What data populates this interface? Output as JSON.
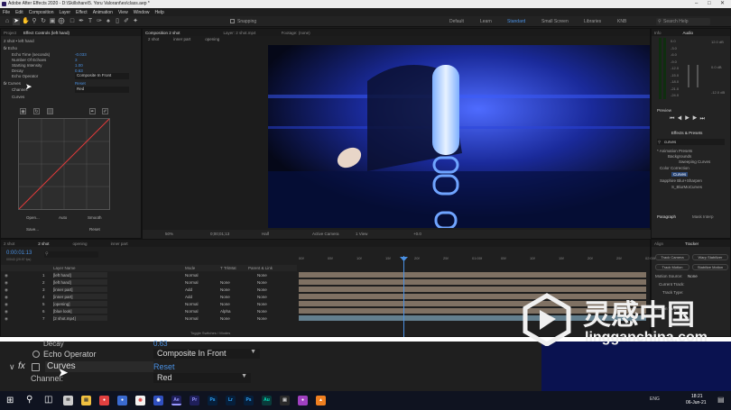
{
  "window": {
    "title": "Adobe After Effects 2020 - D:\\Skillshare\\5. Yoru Valorant\\es\\class.aep *"
  },
  "menu": [
    "File",
    "Edit",
    "Composition",
    "Layer",
    "Effect",
    "Animation",
    "View",
    "Window",
    "Help"
  ],
  "toolbar": {
    "snapping": "Snapping",
    "workspaces": [
      "Default",
      "Learn",
      "Standard",
      "Small Screen",
      "Libraries",
      "KNB"
    ],
    "search_placeholder": "Search Help"
  },
  "effect_controls": {
    "tabs": [
      "Project",
      "Effect Controls (left hand)"
    ],
    "header": "2 shot • left hand",
    "echo": {
      "label": "Echo",
      "reset": "Reset",
      "props": [
        {
          "name": "Echo Time (seconds)",
          "value": "-0.033"
        },
        {
          "name": "Number Of Echoes",
          "value": "3"
        },
        {
          "name": "Starting Intensity",
          "value": "1.00"
        },
        {
          "name": "Decay",
          "value": "0.63"
        },
        {
          "name": "Echo Operator",
          "value": "Composite In Front"
        }
      ]
    },
    "curves": {
      "label": "Curves",
      "reset": "Reset",
      "channel_label": "Channel:",
      "channel_value": "Red",
      "curves_sub": "Curves",
      "buttons": [
        "Open...",
        "Auto",
        "Smooth",
        "Save...",
        "Reset"
      ]
    }
  },
  "composition": {
    "tabs": [
      "Composition 2 shot"
    ],
    "subtabs": [
      "2 shot",
      "inner part",
      "opening"
    ],
    "layer_tab": "Layer: 2 shot.mp4",
    "footage_tab": "Footage: (none)",
    "bottom": {
      "zoom": "50%",
      "time": "0;00;01;13",
      "quality": "Half",
      "camera": "Active Camera",
      "view": "1 View",
      "offset": "+0.0"
    }
  },
  "right_panels": {
    "info_tab": "Info",
    "audio_tab": "Audio",
    "audio_levels": [
      "0.0",
      "-3.0",
      "-6.0",
      "-9.0",
      "-12.0",
      "-15.0",
      "-18.0",
      "-21.0",
      "-24.0"
    ],
    "audio_db_right": [
      "12.0 dB",
      "0.0 dB",
      "-12.0 dB"
    ],
    "preview_tab": "Preview",
    "effects_tab": "Effects & Presets",
    "effects_search": "curves",
    "tree": [
      "* Animation Presets",
      "Backgrounds",
      "Sweeping Curves",
      "Color Correction",
      "Curves",
      "Sapphire Blur+Sharpen",
      "S_BlurMoCurves"
    ],
    "paragraph_tab": "Paragraph",
    "mask_tab": "Mask Interp",
    "align_tab": "Align",
    "tracker_tab": "Tracker",
    "tracker_buttons": [
      "Track Camera",
      "Warp Stabilizer",
      "Track Motion",
      "Stabilize Motion"
    ],
    "tracker_fields": [
      "Motion Source:",
      "Current Track:",
      "Track Type:",
      "Motion Target:"
    ],
    "motion_source_value": "None"
  },
  "timeline": {
    "tabs": [
      "2 shot",
      "2 shot",
      "opening",
      "inner part"
    ],
    "time": "0:00:01:13",
    "fps": "00043 (29.97 fps)",
    "columns": [
      "Layer Name",
      "Mode",
      "T TrkMat",
      "Parent & Link"
    ],
    "layers": [
      {
        "num": "1",
        "name": "[left hand]",
        "mode": "Normal",
        "trk": "",
        "parent": "None"
      },
      {
        "num": "2",
        "name": "[left hand]",
        "mode": "Normal",
        "trk": "None",
        "parent": "None"
      },
      {
        "num": "3",
        "name": "[inner part]",
        "mode": "Add",
        "trk": "None",
        "parent": "None"
      },
      {
        "num": "4",
        "name": "[inner part]",
        "mode": "Add",
        "trk": "None",
        "parent": "None"
      },
      {
        "num": "5",
        "name": "[opening]",
        "mode": "Normal",
        "trk": "None",
        "parent": "None"
      },
      {
        "num": "6",
        "name": "[blue look]",
        "mode": "Normal",
        "trk": "Alpha",
        "parent": "None"
      },
      {
        "num": "7",
        "name": "[2 shot.mp4]",
        "mode": "Normal",
        "trk": "None",
        "parent": "None"
      }
    ],
    "ruler": [
      "00f",
      "05f",
      "10f",
      "15f",
      "20f",
      "25f",
      "01:00f",
      "05f",
      "10f",
      "15f",
      "20f",
      "25f",
      "02:00f"
    ],
    "toggle": "Toggle Switches / Modes"
  },
  "zoom": {
    "decay": "Decay",
    "decay_val": "0.63",
    "operator": "Echo Operator",
    "operator_val": "Composite In Front",
    "fx": "fx",
    "curves": "Curves",
    "reset": "Reset",
    "channel": "Channel:",
    "channel_val": "Red"
  },
  "taskbar": {
    "time": "18:21",
    "date": "06-Jun-21",
    "lang": "ENG",
    "apps": [
      "Ae",
      "Pr",
      "Ps",
      "Lr",
      "Ps",
      "Au"
    ]
  },
  "watermark": {
    "cn": "灵感中国",
    "url": "lingganchina.com"
  },
  "colors": {
    "accent": "#4a90e2",
    "ae": "#9999ff",
    "watermark": "#f0f0f0"
  }
}
